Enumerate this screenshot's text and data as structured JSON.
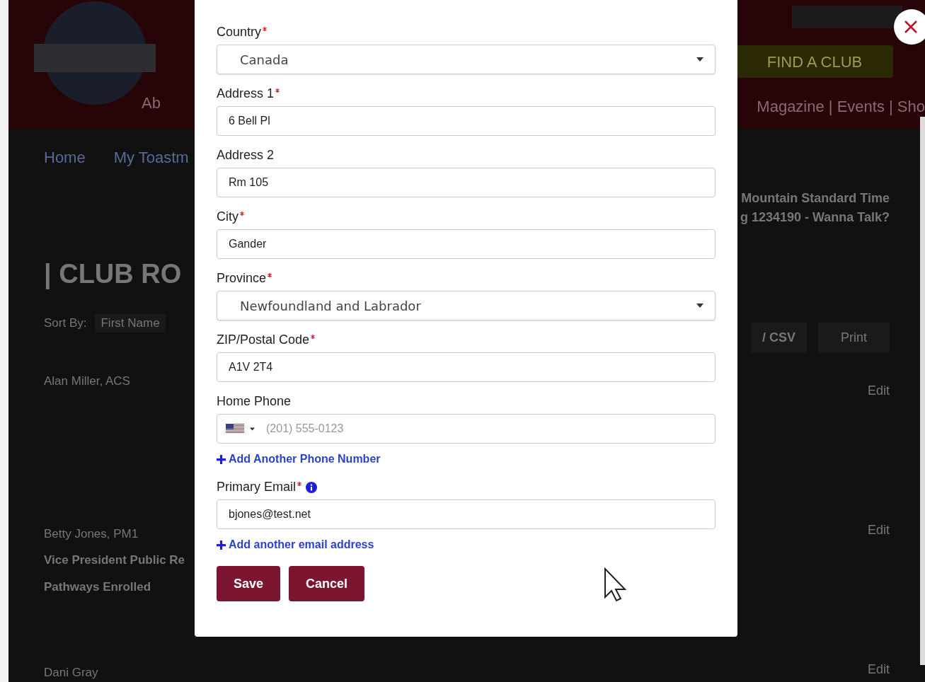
{
  "background": {
    "header": {
      "left_nav": "Ab",
      "right_nav": "Magazine | Events | Sho",
      "find_button": "FIND A CLUB"
    },
    "breadcrumbs": [
      {
        "label": "Home"
      },
      {
        "label": "My Toastm"
      }
    ],
    "club_info": [
      "Mountain Standard Time",
      "g 1234190 - Wanna Talk?"
    ],
    "page_title": "| CLUB RO",
    "sort": {
      "label": "Sort By:",
      "value": "First Name"
    },
    "actions": [
      "/ CSV",
      "Print"
    ],
    "members": [
      {
        "name": "Alan Miller, ACS",
        "edit": "Edit"
      },
      {
        "name": "Betty Jones, PM1",
        "lines": [
          "Vice President Public Re",
          "Pathways Enrolled"
        ],
        "edit": "Edit"
      },
      {
        "name": "Dani Gray",
        "edit": "Edit"
      }
    ]
  },
  "modal": {
    "fields": [
      {
        "kind": "select",
        "label": "Country",
        "required": true,
        "value": "Canada"
      },
      {
        "kind": "text",
        "label": "Address 1",
        "required": true,
        "value": "6 Bell Pl"
      },
      {
        "kind": "text",
        "label": "Address 2",
        "required": false,
        "value": "Rm 105"
      },
      {
        "kind": "text",
        "label": "City",
        "required": true,
        "value": "Gander"
      },
      {
        "kind": "select",
        "label": "Province",
        "required": true,
        "value": "Newfoundland and Labrador"
      },
      {
        "kind": "text",
        "label": "ZIP/Postal Code",
        "required": true,
        "value": "A1V 2T4"
      },
      {
        "kind": "phone",
        "label": "Home Phone",
        "required": false,
        "placeholder": "(201) 555-0123"
      },
      {
        "kind": "link",
        "label": "Add Another Phone Number"
      },
      {
        "kind": "text",
        "label": "Primary Email",
        "required": true,
        "info": true,
        "value": "bjones@test.net"
      },
      {
        "kind": "link",
        "label": "Add another email address"
      }
    ],
    "buttons": [
      "Save",
      "Cancel"
    ]
  }
}
